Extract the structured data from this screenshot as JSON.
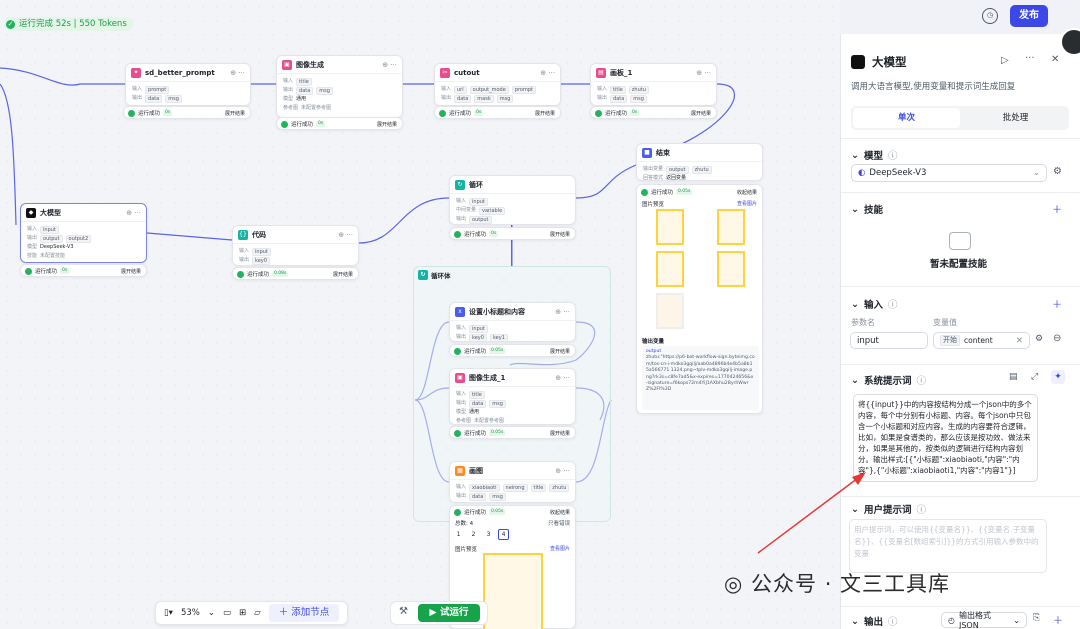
{
  "topbar": {
    "status": "运行完成 52s | 550 Tokens",
    "publish": "发布"
  },
  "edge_color": "#5b63e8",
  "nodes": {
    "sd": {
      "title": "sd_better_prompt",
      "in_label": "输入",
      "in1": "prompt",
      "out_label": "输出",
      "o1": "data",
      "o2": "msg",
      "status": "运行成功",
      "time": "0s",
      "result": "展开结果"
    },
    "imggen": {
      "title": "图像生成",
      "in_label": "输入",
      "in1": "title",
      "out_label": "输出",
      "o1": "data",
      "o2": "msg",
      "model_label": "模型",
      "model": "通用",
      "prompt_label": "参考图",
      "prompt": "未配置参考图",
      "status": "运行成功",
      "time": "0s",
      "result": "展开结果"
    },
    "cutout": {
      "title": "cutout",
      "in_label": "输入",
      "in1": "url",
      "in2": "output_mode",
      "in3": "prompt",
      "out_label": "输出",
      "o1": "data",
      "o2": "mask",
      "o3": "msg",
      "status": "运行成功",
      "time": "0s",
      "result": "展开结果"
    },
    "board": {
      "title": "画板_1",
      "in_label": "输入",
      "in1": "title",
      "in2": "zhutu",
      "out_label": "输出",
      "o1": "data",
      "o2": "msg",
      "status": "运行成功",
      "time": "0s",
      "result": "展开结果"
    },
    "end": {
      "title": "结束",
      "out_label": "输出变量",
      "o1": "output",
      "o2": "zhutu",
      "mode_label": "回答模式",
      "mode": "返回变量",
      "status": "运行成功",
      "time": "0.05s",
      "result": "收起结果",
      "preview": "图片预览",
      "preview_link": "查看图片",
      "outvars": "输出变量",
      "output_key": "output",
      "output_text": "zhutu:\"https://p6-bot-workflow-sign.byteimg.com/tos-cn-i-mdko3gqilj/aab0a4896b4e4b5a8b15a566771 1324.png~tplv-mdko3gqilj-image.png?rk3s=c8fe7ad5&x-expires=1770424656&x-signature=f6kops72m4YiJ1AXbhu2ByrhWwrZ%2FI%3D"
    },
    "llm": {
      "title": "大模型",
      "in_label": "输入",
      "in1": "input",
      "out_label": "输出",
      "o1": "output",
      "o2": "output2",
      "model_label": "模型",
      "model": "DeepSeek-V3",
      "skill_label": "技能",
      "skill": "未配置技能",
      "status": "运行成功",
      "time": "0s",
      "result": "展开结果"
    },
    "code": {
      "title": "代码",
      "in_label": "输入",
      "in1": "input",
      "out_label": "输出",
      "o1": "key0",
      "status": "运行成功",
      "time": "0.08s",
      "result": "展开结果"
    },
    "loop": {
      "title": "循环",
      "in_label": "输入",
      "in1": "input",
      "var_label": "中间变量",
      "var1": "variable",
      "out_label": "输出",
      "o1": "output",
      "status": "运行成功",
      "time": "0s",
      "result": "展开结果"
    },
    "loopbody": {
      "title": "循环体"
    },
    "setvar": {
      "title": "设置小标题和内容",
      "in_label": "输入",
      "in1": "input",
      "out_label": "输出",
      "o1": "key0",
      "o2": "key1",
      "status": "运行成功",
      "time": "0.05s",
      "result": "展开结果"
    },
    "imggen1": {
      "title": "图像生成_1",
      "in_label": "输入",
      "in1": "title",
      "out_label": "输出",
      "o1": "data",
      "o2": "msg",
      "model_label": "模型",
      "model": "通用",
      "prompt_label": "参考图",
      "prompt": "未配置参考图",
      "status": "运行成功",
      "time": "0.05s",
      "result": "展开结果"
    },
    "canvas": {
      "title": "画图",
      "in_label": "输入",
      "in1": "xiaobiaoti",
      "in2": "neirong",
      "in3": "title",
      "in4": "zhutu",
      "out_label": "输出",
      "o1": "data",
      "o2": "msg",
      "status": "运行成功",
      "time": "0.05s",
      "result": "收起结果",
      "total": "总数: 4",
      "pages": [
        "1",
        "2",
        "3",
        "4"
      ],
      "only_err": "只看错误",
      "preview": "图片预览",
      "preview_link": "查看图片"
    }
  },
  "toolbar": {
    "zoom": "53%",
    "add_node": "添加节点",
    "run": "试运行"
  },
  "panel": {
    "title": "大模型",
    "desc": "调用大语言模型,使用变量和提示词生成回复",
    "tabs": [
      "单次",
      "批处理"
    ],
    "model_title": "模型",
    "model_value": "DeepSeek-V3",
    "skill_title": "技能",
    "skill_empty": "暂未配置技能",
    "input_title": "输入",
    "col_name": "参数名",
    "col_value": "变量值",
    "param_name": "input",
    "ref_node": "开始",
    "ref_var": "content",
    "sys_title": "系统提示词",
    "sys_prompt": "将{{input}}中的内容按结构分成一个json中的多个内容，每个中分别有小标题、内容。每个json中只包含一个小标题和对应内容。生成的内容要符合逻辑，比如，如果是食谱类的，那么应该是按功效、做法来分，如果是其他的，按类似的逻辑进行结构内容划分。输出样式:[{\"小标题\":xiaobiaoti,\"内容\":\"内容\"},{\"小标题\":xiaobiaoti1,\"内容\":\"内容1\"}]",
    "user_title": "用户提示词",
    "user_placeholder": "用户提示词，可以使用{{变量名}}、{{变量名.子变量名}}、{{变量名[数组索引]}}的方式引用输入参数中的变量",
    "output_title": "输出",
    "output_format": "输出格式JSON"
  },
  "watermark": "公众号 · 文三工具库"
}
